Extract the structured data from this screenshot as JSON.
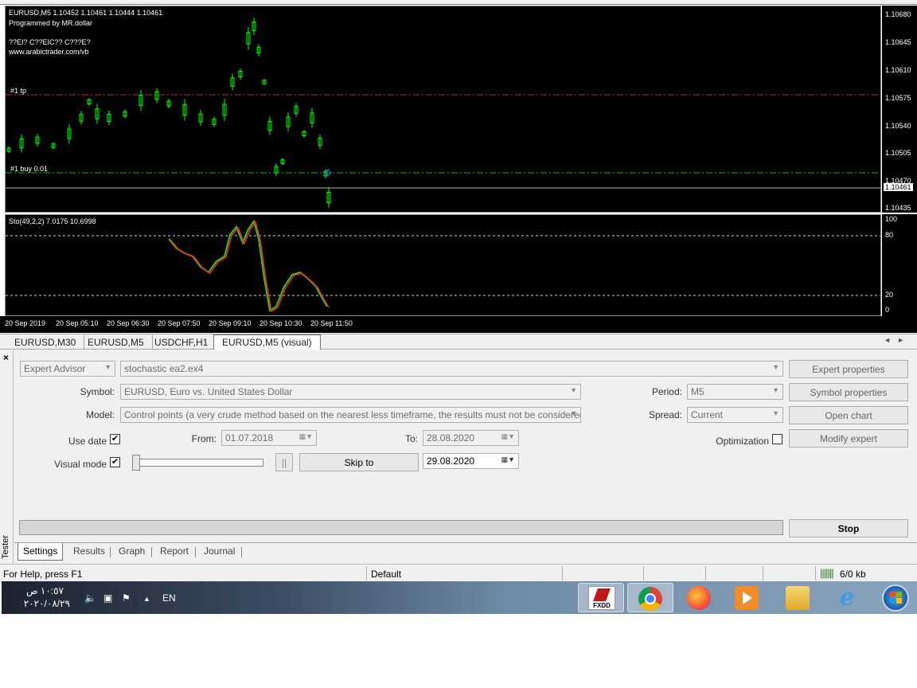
{
  "chart": {
    "symbol_line": "EURUSD,M5  1.10452 1.10461 1.10444 1.10461",
    "programmed_by": "Programmed by MR.dollar",
    "garbled_line": "??EI? C??EIC?? C???E?",
    "website": "www.arabictrader.com/vb",
    "tp_label": "#1 tp",
    "buy_label": "#1 buy 0.01",
    "current_price": "1.10461",
    "price_ticks": [
      "1.10680",
      "1.10645",
      "1.10610",
      "1.10575",
      "1.10540",
      "1.10505",
      "1.10470",
      "1.10435"
    ],
    "stoch_label": "Sto(49,2,2) 7.0175 10.6998",
    "stoch_ticks": [
      "100",
      "80",
      "20",
      "0"
    ],
    "time_ticks": [
      "20 Sep 2019",
      "20 Sep 05:10",
      "20 Sep 06:30",
      "20 Sep 07:50",
      "20 Sep 09:10",
      "20 Sep 10:30",
      "20 Sep 11:50"
    ],
    "colors": {
      "background": "#000000",
      "candles": "#00ff00",
      "tp_line": "#cc2222",
      "buy_line": "#22aa22",
      "stoch_main": "#22cc22",
      "stoch_signal": "#ff2222"
    }
  },
  "chart_tabs": [
    "EURUSD,M30",
    "EURUSD,M5",
    "USDCHF,H1",
    "EURUSD,M5 (visual)"
  ],
  "tester": {
    "title": "Tester",
    "close": "×",
    "type_select": "Expert Advisor",
    "expert_file": "stochastic ea2.ex4",
    "symbol_label": "Symbol:",
    "symbol_value": "EURUSD, Euro vs. United States Dollar",
    "model_label": "Model:",
    "model_value": "Control points (a very crude method based on the nearest less timeframe, the results must not be considered)",
    "use_date_label": "Use date",
    "from_label": "From:",
    "from_value": "01.07.2018",
    "to_label": "To:",
    "to_value": "28.08.2020",
    "visual_mode_label": "Visual mode",
    "pause_glyph": "||",
    "skip_to_label": "Skip to",
    "skip_to_date": "29.08.2020",
    "period_label": "Period:",
    "period_value": "M5",
    "spread_label": "Spread:",
    "spread_value": "Current",
    "optimization_label": "Optimization",
    "btn_expert_properties": "Expert properties",
    "btn_symbol_properties": "Symbol properties",
    "btn_open_chart": "Open chart",
    "btn_modify_expert": "Modify expert",
    "btn_stop": "Stop",
    "use_date_checked": true,
    "visual_mode_checked": true,
    "optimization_checked": false,
    "tabs": [
      "Settings",
      "Results",
      "Graph",
      "Report",
      "Journal"
    ]
  },
  "statusbar": {
    "help": "For Help, press F1",
    "profile": "Default",
    "traffic": "6/0 kb"
  },
  "taskbar": {
    "time": "١٠:٥٧ ص",
    "date": "٢٠٢٠/٠٨/٢٩",
    "language": "EN",
    "apps": [
      "fxdd-icon",
      "chrome-icon",
      "firefox-icon",
      "media-player-icon",
      "file-explorer-icon",
      "internet-explorer-icon",
      "windows-start-icon"
    ],
    "fxdd_label": "FXDD"
  }
}
